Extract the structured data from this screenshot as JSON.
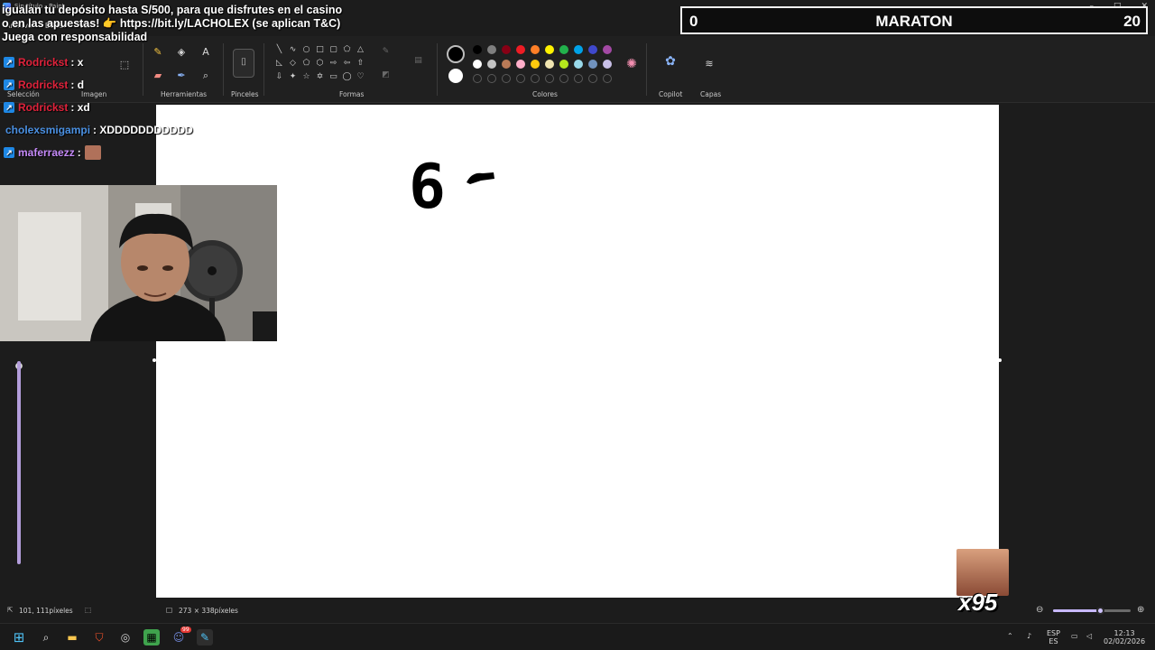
{
  "window": {
    "title": "Sin título - Paint"
  },
  "menu": [
    "Archivo",
    "Editar",
    "Ver"
  ],
  "ribbon": {
    "groups": {
      "seleccion": "Selección",
      "imagen": "Imagen",
      "herramientas": "Herramientas",
      "pinceles": "Pinceles",
      "formas": "Formas",
      "colores": "Colores",
      "copilot": "Copilot",
      "capas": "Capas"
    },
    "palette_row1": [
      "#000000",
      "#7f7f7f",
      "#880015",
      "#ed1c24",
      "#ff7f27",
      "#fff200",
      "#22b14c",
      "#00a2e8",
      "#3f48cc",
      "#a349a4"
    ],
    "palette_row2": [
      "#ffffff",
      "#c3c3c3",
      "#b97a57",
      "#ffaec9",
      "#ffc90e",
      "#efe4b0",
      "#b5e61d",
      "#99d9ea",
      "#7092be",
      "#c8bfe7"
    ],
    "primary_color": "#000000",
    "secondary_color": "#ffffff"
  },
  "canvas": {
    "drawing_text": "6"
  },
  "status": {
    "cursor_position": "101, 111píxeles",
    "selection_size": "273 × 338píxeles"
  },
  "taskbar": {
    "lang_top": "ESP",
    "lang_bottom": "ES",
    "time": "12:13",
    "date": "02/02/2026",
    "discord_badge": "99"
  },
  "overlay": {
    "announcement": "igualan tu depósito hasta S/500, para que disfrutes en el casino o en las apuestas! 👉 https://bit.ly/LACHOLEX (se aplican T&C) Juega con responsabilidad",
    "chat": [
      {
        "user": "Rodrickst",
        "message": ": x",
        "color": "#e0223b",
        "badge": true
      },
      {
        "user": "Rodrickst",
        "message": ": d",
        "color": "#e0223b",
        "badge": true
      },
      {
        "user": "Rodrickst",
        "message": ": xd",
        "color": "#e0223b",
        "badge": true
      },
      {
        "user": "cholexsmigampi",
        "message": ": XDDDDDDDDDDD",
        "color": "#4a90e2",
        "badge": false
      },
      {
        "user": "maferraezz",
        "message": ":",
        "color": "#c58af9",
        "badge": true
      }
    ],
    "score": {
      "left": "0",
      "title": "MARATON",
      "right": "20"
    },
    "emote_counter": "x95"
  }
}
